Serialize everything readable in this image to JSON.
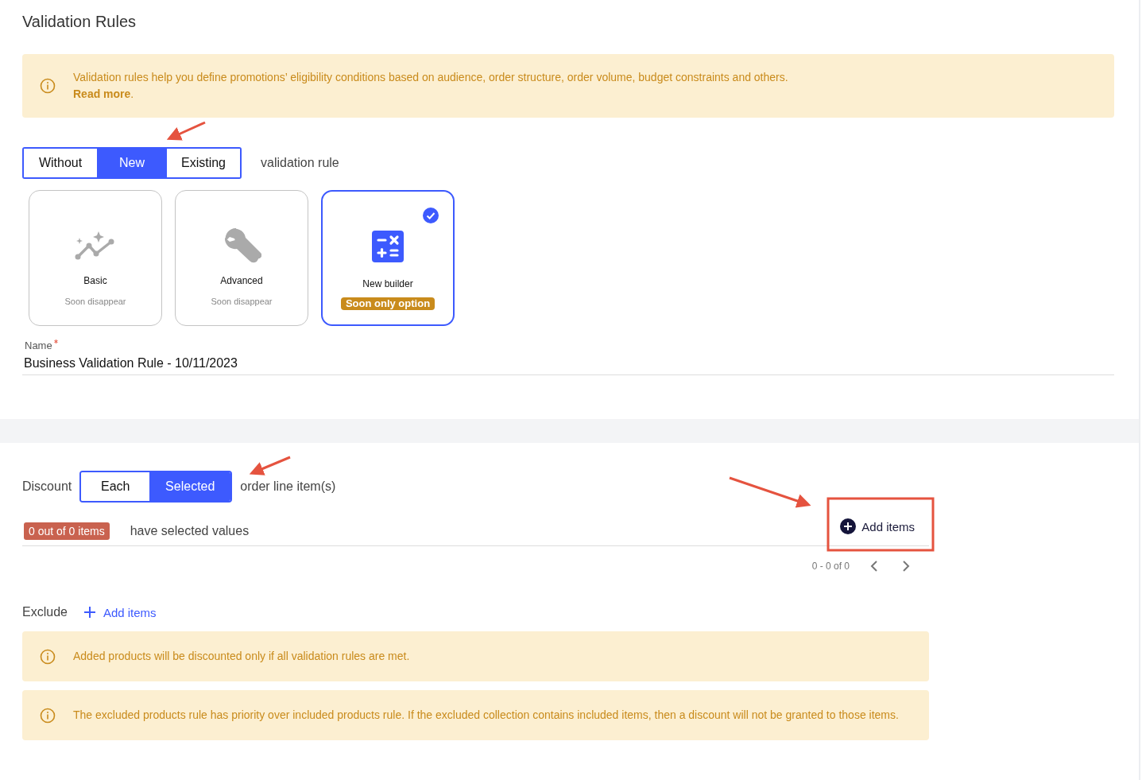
{
  "page": {
    "title": "Validation Rules"
  },
  "intro_notice": {
    "text": "Validation rules help you define promotions’ eligibility conditions based on audience, order structure, order volume, budget constraints and others.",
    "link": "Read more",
    "link_suffix": "."
  },
  "rule_mode": {
    "options": [
      {
        "label": "Without",
        "selected": false
      },
      {
        "label": "New",
        "selected": true
      },
      {
        "label": "Existing",
        "selected": false
      }
    ],
    "suffix": "validation rule"
  },
  "rule_types": [
    {
      "kind": "basic",
      "title": "Basic",
      "subtitle": "Soon disappear",
      "selected": false
    },
    {
      "kind": "advanced",
      "title": "Advanced",
      "subtitle": "Soon disappear",
      "selected": false
    },
    {
      "kind": "builder",
      "title": "New builder",
      "badge": "Soon only option",
      "selected": true
    }
  ],
  "name_field": {
    "label": "Name",
    "required": true,
    "value": "Business Validation Rule - 10/11/2023"
  },
  "discount": {
    "label": "Discount",
    "options": [
      {
        "label": "Each",
        "selected": false
      },
      {
        "label": "Selected",
        "selected": true
      }
    ],
    "suffix": "order line item(s)",
    "count_badge": "0 out of 0 items",
    "count_text": "have selected values",
    "add_button": "Add items",
    "pagination": "0 - 0 of 0"
  },
  "exclude": {
    "label": "Exclude",
    "add_link": "Add items"
  },
  "notices": [
    {
      "text": "Added products will be discounted only if all validation rules are met."
    },
    {
      "text": "The excluded products rule has priority over included products rule. If the excluded collection contains included items, then a discount will not be granted to those items."
    }
  ]
}
